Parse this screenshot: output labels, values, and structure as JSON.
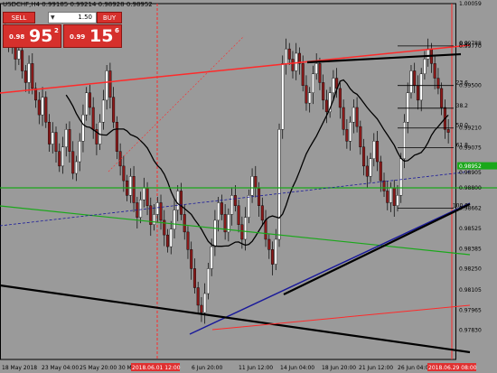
{
  "title": "USDCHF,H4  0.99185 0.99214 0.98928 0.98952",
  "panel": {
    "sell_label": "SELL",
    "buy_label": "BUY",
    "quantity": "1.50",
    "sell_small": "0.98",
    "sell_big": "95",
    "sell_sup": "2",
    "buy_small": "0.99",
    "buy_big": "15",
    "buy_sup": "6"
  },
  "colors": {
    "background": "#9a9a9a",
    "bull_candle": "#ffffff",
    "bear_candle": "#8b1a1a",
    "wick": "#000000",
    "ma": "#000000",
    "trend_red": "#ff2a2a",
    "trend_blue": "#1a1a9a",
    "trend_green": "#1aa81a",
    "current_price_label": "#1aa81a",
    "fib": "#000000",
    "date_highlight": "#e03030"
  },
  "chart_data": {
    "type": "candlestick",
    "symbol": "USDCHF",
    "timeframe": "H4",
    "ohlc": {
      "open": 0.99185,
      "high": 0.99214,
      "low": 0.98928,
      "close": 0.98952
    },
    "ylim": [
      0.9763,
      1.00059
    ],
    "y_ticks": [
      "1.00059",
      "0.99788",
      "0.99770",
      "0.99500",
      "0.99210",
      "0.99075",
      "0.98905",
      "0.98800",
      "0.98662",
      "0.98525",
      "0.98385",
      "0.98250",
      "0.98105",
      "0.97965",
      "0.97830"
    ],
    "x_labels": [
      "18 May 2018",
      "23 May 04:00",
      "25 May 20:00",
      "30 M",
      "6 Jun 20:00",
      "11 Jun 12:00",
      "14 Jun 04:00",
      "18 Jun 20:00",
      "21 Jun 12:00",
      "26 Jun 04:00"
    ],
    "x_highlight_labels": [
      "2018.06.01 12:00",
      "2018.06.29 08:00"
    ],
    "current_price": "0.98952",
    "fib_levels": [
      {
        "label": "0.0",
        "value": 0.9977
      },
      {
        "label": "23.6",
        "value": 0.995
      },
      {
        "label": "38.2",
        "value": 0.99345
      },
      {
        "label": "50.0",
        "value": 0.9921
      },
      {
        "label": "61.8",
        "value": 0.99075
      },
      {
        "label": "100.0",
        "value": 0.98662
      }
    ],
    "candles_close": [
      0.9985,
      0.9978,
      0.9981,
      0.9968,
      0.9974,
      0.996,
      0.9952,
      0.9965,
      0.9948,
      0.994,
      0.993,
      0.9942,
      0.9925,
      0.991,
      0.9918,
      0.9905,
      0.9895,
      0.9908,
      0.992,
      0.9905,
      0.989,
      0.9898,
      0.9912,
      0.993,
      0.9945,
      0.9935,
      0.992,
      0.991,
      0.9925,
      0.994,
      0.996,
      0.9942,
      0.9925,
      0.9905,
      0.9895,
      0.9885,
      0.9875,
      0.9888,
      0.987,
      0.986,
      0.9872,
      0.988,
      0.9868,
      0.9855,
      0.9862,
      0.987,
      0.9858,
      0.9848,
      0.984,
      0.9852,
      0.9865,
      0.9878,
      0.9862,
      0.985,
      0.9838,
      0.9825,
      0.9812,
      0.98,
      0.9795,
      0.9808,
      0.9825,
      0.984,
      0.9858,
      0.987,
      0.9862,
      0.985,
      0.9862,
      0.9875,
      0.9868,
      0.9855,
      0.9845,
      0.986,
      0.9875,
      0.9888,
      0.988,
      0.9868,
      0.9858,
      0.9845,
      0.9838,
      0.9828,
      0.9845,
      0.992,
      0.9965,
      0.9975,
      0.9968,
      0.996,
      0.9972,
      0.9965,
      0.995,
      0.9938,
      0.9945,
      0.9958,
      0.9965,
      0.9952,
      0.994,
      0.9932,
      0.9945,
      0.9955,
      0.9948,
      0.9935,
      0.992,
      0.9912,
      0.9925,
      0.9935,
      0.9922,
      0.9908,
      0.9895,
      0.9888,
      0.99,
      0.9912,
      0.9898,
      0.9885,
      0.9878,
      0.987,
      0.988,
      0.9868,
      0.9875,
      0.99,
      0.9925,
      0.9945,
      0.996,
      0.995,
      0.994,
      0.9958,
      0.9968,
      0.9975,
      0.9965,
      0.9955,
      0.9948,
      0.9935,
      0.992,
      0.9918
    ]
  }
}
